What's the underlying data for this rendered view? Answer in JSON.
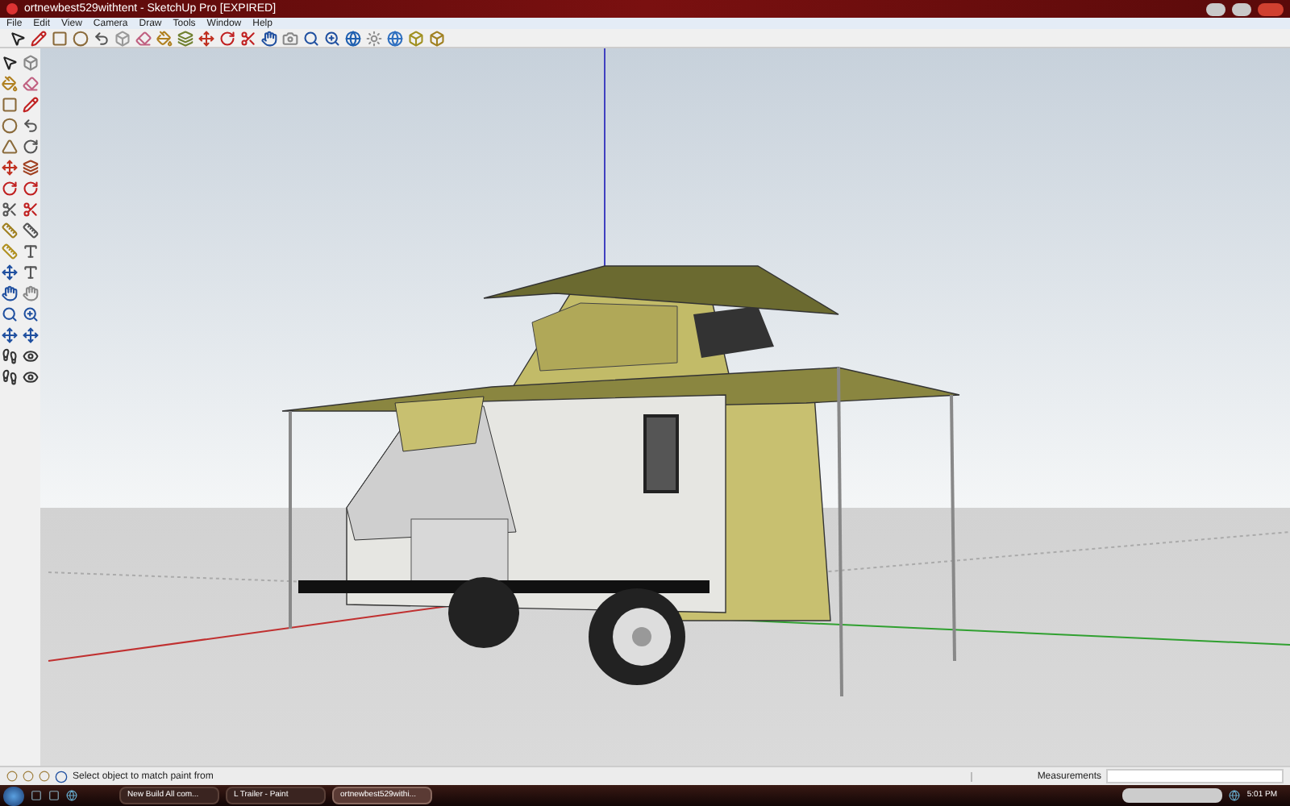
{
  "window": {
    "title": "ortnewbest529withtent - SketchUp Pro [EXPIRED]"
  },
  "menu": [
    "File",
    "Edit",
    "View",
    "Camera",
    "Draw",
    "Tools",
    "Window",
    "Help"
  ],
  "status_bar": {
    "message": "Select object to match paint from",
    "measurements_label": "Measurements"
  },
  "taskbar": {
    "items": [
      {
        "label": "New Build All com...",
        "selected": false
      },
      {
        "label": "L Trailer - Paint",
        "selected": false
      },
      {
        "label": "ortnewbest529withi...",
        "selected": true
      }
    ],
    "clock": "5:01 PM"
  }
}
